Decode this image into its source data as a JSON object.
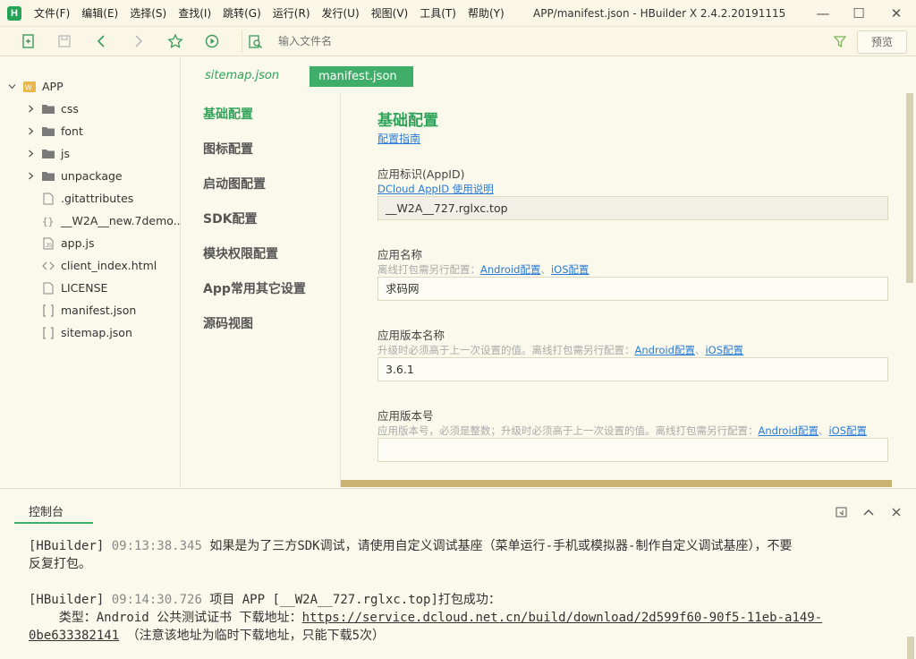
{
  "titlebar": {
    "logo": "H",
    "menus": [
      "文件(F)",
      "编辑(E)",
      "选择(S)",
      "查找(I)",
      "跳转(G)",
      "运行(R)",
      "发行(U)",
      "视图(V)",
      "工具(T)",
      "帮助(Y)"
    ],
    "title": "APP/manifest.json - HBuilder X 2.4.2.20191115",
    "minimize": "—",
    "maximize": "☐",
    "close": "✕"
  },
  "toolbar": {
    "search_placeholder": "输入文件名",
    "preview_label": "预览",
    "icons": [
      "new-file-icon",
      "save-icon",
      "back-icon",
      "forward-icon",
      "star-icon",
      "run-icon",
      "file-search-icon",
      "filter-icon"
    ]
  },
  "sidebar": {
    "root": {
      "label": "APP",
      "icon": "project-icon"
    },
    "items": [
      {
        "label": "css",
        "type": "folder"
      },
      {
        "label": "font",
        "type": "folder"
      },
      {
        "label": "js",
        "type": "folder"
      },
      {
        "label": "unpackage",
        "type": "folder"
      },
      {
        "label": ".gitattributes",
        "type": "file"
      },
      {
        "label": "__W2A__new.7demo...",
        "type": "json-file"
      },
      {
        "label": "app.js",
        "type": "js-file"
      },
      {
        "label": "client_index.html",
        "type": "html-file"
      },
      {
        "label": "LICENSE",
        "type": "file"
      },
      {
        "label": "manifest.json",
        "type": "bracket-file"
      },
      {
        "label": "sitemap.json",
        "type": "bracket-file"
      }
    ]
  },
  "editor": {
    "tabs": {
      "sitemap": "sitemap.json",
      "manifest": "manifest.json"
    },
    "nav": [
      "基础配置",
      "图标配置",
      "启动图配置",
      "SDK配置",
      "模块权限配置",
      "App常用其它设置",
      "源码视图"
    ],
    "form": {
      "title": "基础配置",
      "guide_link": "配置指南",
      "appid_label": "应用标识(AppID)",
      "appid_link": "DCloud AppID 使用说明",
      "appid_value": "__W2A__727.rglxc.top",
      "name_label": "应用名称",
      "name_hint": "离线打包需另行配置：",
      "name_value": "求码网",
      "version_name_label": "应用版本名称",
      "version_name_hint": "升级时必须高于上一次设置的值。离线打包需另行配置：",
      "version_name_value": "3.6.1",
      "version_code_label": "应用版本号",
      "version_code_hint": "应用版本号，必须是整数；升级时必须高于上一次设置的值。离线打包需另行配置：",
      "version_code_value": "",
      "android_link": "Android配置",
      "ios_link": "iOS配置",
      "separator": "、"
    }
  },
  "console": {
    "tab": "控制台",
    "line1_prefix": "[HBuilder]",
    "line1_time": "09:13:38.345",
    "line1_text": "如果是为了三方SDK调试，请使用自定义调试基座（菜单运行-手机或模拟器-制作自定义调试基座），不要",
    "line2_text": "反复打包。",
    "line3_prefix": "[HBuilder]",
    "line3_time": "09:14:30.726",
    "line3_text": "项目 APP [__W2A__727.rglxc.top]打包成功：",
    "line4_text": "    类型：Android 公共测试证书 下载地址：",
    "line4_link": "https://service.dcloud.net.cn/build/download/2d599f60-90f5-11eb-a149-",
    "line5_link": "0be633382141",
    "line5_text": " （注意该地址为临时下载地址，只能下载5次）"
  }
}
